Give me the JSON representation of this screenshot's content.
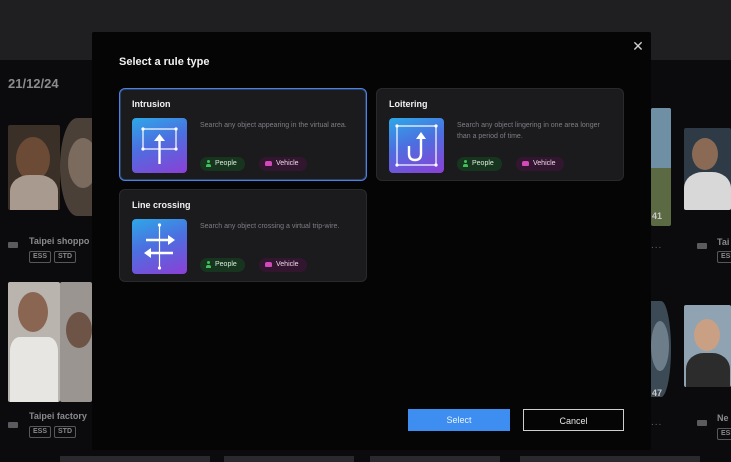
{
  "background": {
    "date_label": "21/12/24",
    "cameras": [
      {
        "name": "Taipei shoppo",
        "tags": [
          "ESS",
          "STD"
        ]
      },
      {
        "name": "Taipei factory",
        "tags": [
          "ESS",
          "STD"
        ]
      },
      {
        "name": "Tai",
        "tags": [
          "ESS"
        ]
      },
      {
        "name": "Ne",
        "tags": [
          "ESS"
        ]
      }
    ],
    "overflow_dots": "...",
    "side_numbers": [
      "41",
      "47"
    ]
  },
  "modal": {
    "title": "Select a rule type",
    "close_icon": "close-icon",
    "rule_types": [
      {
        "title": "Intrusion",
        "description": "Search any object appearing in the virtual area.",
        "icon": "intrusion-icon",
        "tags": [
          "People",
          "Vehicle"
        ],
        "selected": true
      },
      {
        "title": "Loitering",
        "description": "Search any object lingering in one area longer than a period of time.",
        "icon": "loitering-icon",
        "tags": [
          "People",
          "Vehicle"
        ],
        "selected": false
      },
      {
        "title": "Line crossing",
        "description": "Search any object crossing a virtual trip-wire.",
        "icon": "line-crossing-icon",
        "tags": [
          "People",
          "Vehicle"
        ],
        "selected": false
      }
    ],
    "select_label": "Select",
    "cancel_label": "Cancel"
  },
  "colors": {
    "accent": "#3d8ef0",
    "selected_border": "#4a83e6",
    "people_badge": "#17341f",
    "vehicle_badge": "#32162f"
  }
}
